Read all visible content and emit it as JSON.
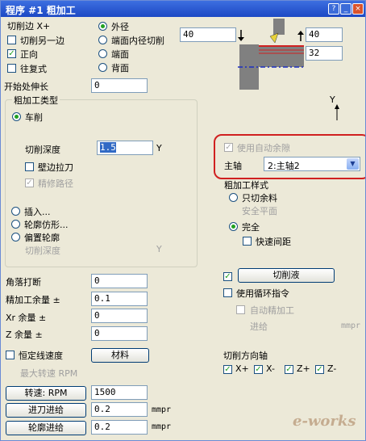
{
  "window": {
    "title": "程序 #1 粗加工",
    "help": "?",
    "minimize": "_",
    "close": "×"
  },
  "cut_side": {
    "label": "切削边 X+",
    "cut_other_side": "切削另一边",
    "forward": "正向",
    "reciprocal": "往复式",
    "position_options": [
      "外径",
      "端面内径切削",
      "端面",
      "背面"
    ],
    "selected": "外径"
  },
  "tool_graphic": {
    "input1": "40",
    "input2": "40",
    "input3": "32"
  },
  "start_extension": {
    "label": "开始处伸长",
    "value": "0"
  },
  "rough_type": {
    "group_label": "粗加工类型",
    "turning": "车削",
    "cut_depth_label": "切削深度",
    "cut_depth_value": "1.5",
    "cut_depth_axis": "Y",
    "wall_retract": "壁边拉刀",
    "finish_path": "精修路径",
    "plunge": "插入...",
    "profile": "轮廓仿形...",
    "offset_profile": "偏置轮廓",
    "offset_cut_depth": "切削深度",
    "offset_axis": "Y"
  },
  "axis_marker": "Y",
  "auto_clearance": {
    "label": "使用自动余隙"
  },
  "spindle": {
    "label": "主轴",
    "value": "2:主轴2"
  },
  "rough_style": {
    "label": "粗加工样式",
    "cut_only": "只切余料",
    "safe_plane": "安全平面",
    "complete": "完全",
    "quick_gap": "快速间距"
  },
  "corner_break": {
    "label": "角落打断",
    "value": "0"
  },
  "finish_allowance": {
    "label": "精加工余量 ±",
    "value": "0.1"
  },
  "xr_allowance": {
    "label": "Xr 余量 ±",
    "value": "0"
  },
  "z_allowance": {
    "label": "Z 余量 ±",
    "value": "0"
  },
  "constant_speed": {
    "label": "恒定线速度",
    "material_button": "材料",
    "max_speed": "最大转速 RPM"
  },
  "speed": {
    "button": "转速: RPM",
    "value": "1500"
  },
  "feed_in": {
    "button": "进刀进给",
    "value": "0.2",
    "unit": "mmpr"
  },
  "profile_feed": {
    "button": "轮廓进给",
    "value": "0.2",
    "unit": "mmpr"
  },
  "coolant": {
    "button": "切削液"
  },
  "cycle": {
    "label": "使用循环指令",
    "auto_finish": "自动精加工",
    "feed": "进给",
    "feed_unit": "mmpr"
  },
  "direction_axis": {
    "label": "切削方向轴",
    "options": [
      "X+",
      "X-",
      "Z+",
      "Z-"
    ]
  },
  "watermark": "e-works"
}
